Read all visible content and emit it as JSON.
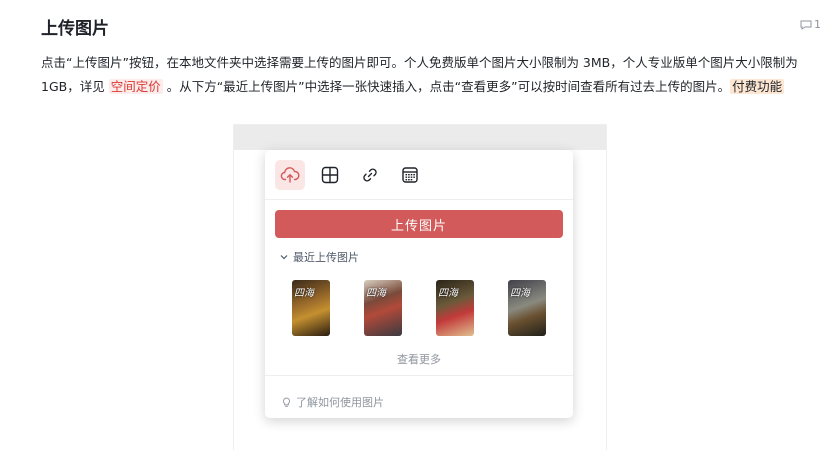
{
  "doc": {
    "title": "上传图片",
    "comment_count": "1"
  },
  "para": {
    "part1": "点击“上传图片”按钮，在本地文件夹中选择需要上传的图片即可。个人免费版单个图片大小限制为 3MB，个人专业版单个图片大小限制为 1GB，详见 ",
    "link1": "空间定价",
    "part2": " 。从下方“最近上传图片”中选择一张快速插入，点击“查看更多”可以按时间查看所有过去上传的图片。",
    "link2": "付费功能"
  },
  "panel": {
    "tools": [
      "upload-cloud-icon",
      "table-grid-icon",
      "link-icon",
      "calendar-icon"
    ],
    "upload_button": "上传图片",
    "recent_label": "最近上传图片",
    "thumb_caption": "四海",
    "see_more": "查看更多",
    "learn_more": "了解如何使用图片"
  },
  "colors": {
    "accent": "#d35a5a",
    "link_red": "#d83931",
    "link_bg": "#fdecec",
    "paid_bg": "#fde6d2"
  }
}
